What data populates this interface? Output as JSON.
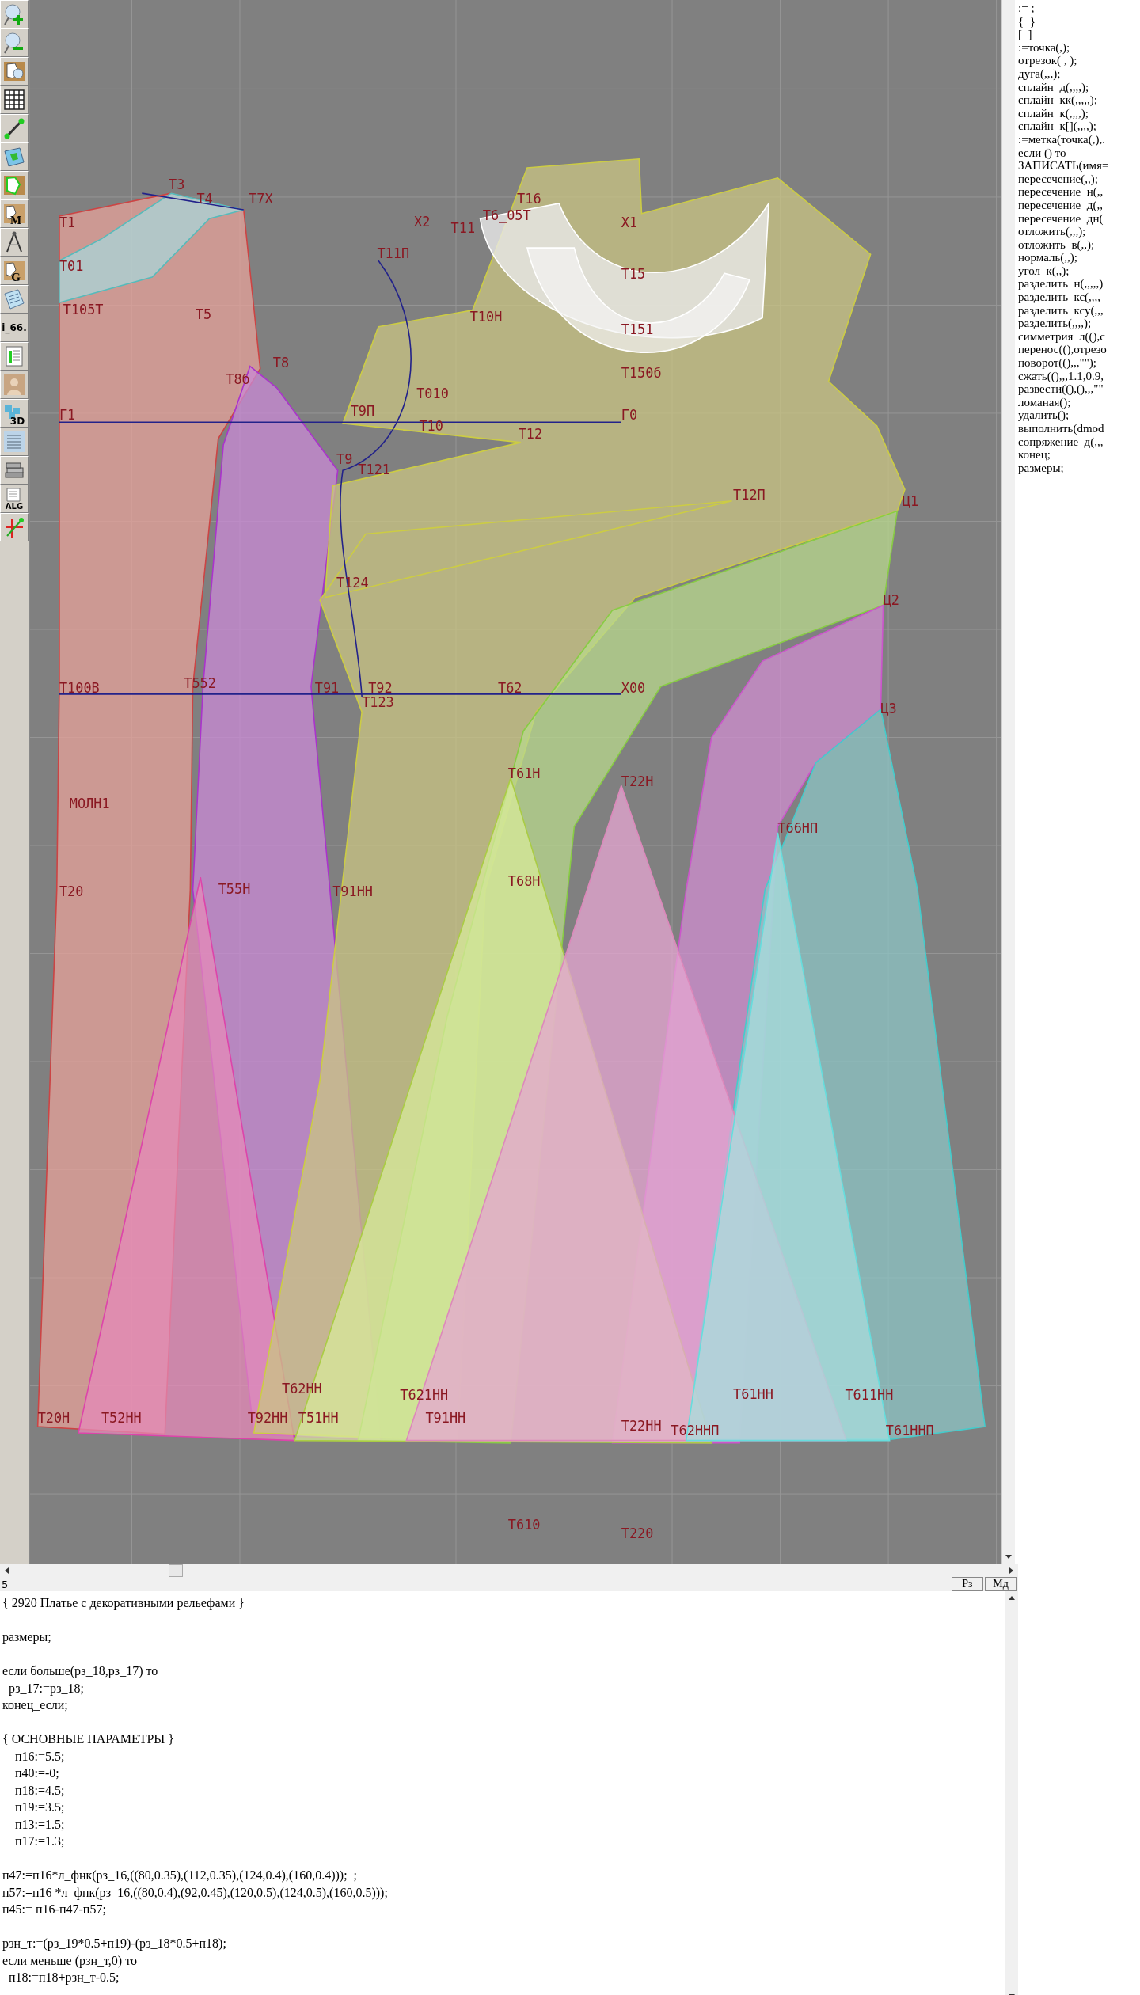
{
  "toolbar": {
    "buttons": [
      {
        "kind": "zoom-in"
      },
      {
        "kind": "zoom-out"
      },
      {
        "kind": "pattern-zoom"
      },
      {
        "kind": "grid"
      },
      {
        "kind": "segment"
      },
      {
        "kind": "map"
      },
      {
        "kind": "pattern-outline"
      },
      {
        "kind": "pattern-letter",
        "text": "M"
      },
      {
        "kind": "compass"
      },
      {
        "kind": "pattern-letter",
        "text": "G"
      },
      {
        "kind": "sheet"
      },
      {
        "kind": "label",
        "text": "i_66."
      },
      {
        "kind": "table"
      },
      {
        "kind": "photo"
      },
      {
        "kind": "cubes",
        "text": "3D"
      },
      {
        "kind": "list"
      },
      {
        "kind": "books"
      },
      {
        "kind": "doc-letter",
        "text": "ALG"
      },
      {
        "kind": "axes"
      }
    ]
  },
  "canvas": {
    "labels": [
      "Т1",
      "Т3",
      "Т4",
      "Т01",
      "Т105Т",
      "Т5",
      "Т7Х",
      "Т8",
      "Т8б",
      "Г1",
      "Т010",
      "Т9П",
      "Т10",
      "Т12",
      "Т9",
      "Т121",
      "Т11П",
      "Х2",
      "Т11",
      "Т16",
      "Т6_05Т",
      "Х1",
      "Т15",
      "Т10Н",
      "Т151",
      "Т150б",
      "Г0",
      "Т12П",
      "Ц1",
      "Ц2",
      "Ц3",
      "Т124",
      "Т100В",
      "Т552",
      "Т91",
      "Т92",
      "Т123",
      "Т62",
      "Х00",
      "Т61Н",
      "Т22Н",
      "Т66НП",
      "МОЛН1",
      "Т20",
      "Т55Н",
      "Т91НН",
      "Т68Н",
      "Т62НН",
      "Т621НН",
      "Т61НН",
      "Т611НН",
      "Т20Н",
      "Т52НН",
      "Т92НН",
      "Т51НН",
      "Т91НН",
      "Т22НН",
      "Т62ННП",
      "Т61ННП",
      "Т610",
      "Т220"
    ]
  },
  "status_bar": {
    "value": "5",
    "buttons": [
      "Рз",
      "Мд"
    ]
  },
  "command_list": [
    ":= ;",
    "{  }",
    "[  ]",
    ":=точка(,);",
    "отрезок( , );",
    "дуга(,,,);",
    "сплайн  д(,,,,);",
    "сплайн  кк(,,,,,);",
    "сплайн  к(,,,,);",
    "сплайн  к[](,,,,);",
    ":=метка(точка(,),.",
    "если () то",
    "ЗАПИСАТЬ(имя=",
    "пересечение(,,);",
    "пересечение  н(,,",
    "пересечение  д(,,",
    "пересечение  дн(",
    "отложить(,,,);",
    "отложить  в(,,);",
    "нормаль(,,);",
    "угол  к(,,);",
    "разделить  н(,,,,,)",
    "разделить  кс(,,,,",
    "разделить  ксу(,,,",
    "разделить(,,,,);",
    "симметрия  л((),с",
    "перенос((),отрезо",
    "поворот((),,,\"\");",
    "сжать((),,,1.1,0.9,",
    "развести((),(),,,\"\"",
    "ломаная();",
    "удалить();",
    "выполнить(dmod",
    "сопряжение  д(,,,",
    "конец;",
    "размеры;"
  ],
  "editor": {
    "blocks": [
      [
        "{ 2920 Платье с декоративными рельефами }"
      ],
      [
        "размеры;"
      ],
      [
        "если больше(рз_18,рз_17) то",
        "  рз_17:=рз_18;",
        "конец_если;"
      ],
      [
        "{ ОСНОВНЫЕ ПАРАМЕТРЫ }",
        "    п16:=5.5;",
        "    п40:=-0;",
        "    п18:=4.5;",
        "    п19:=3.5;",
        "    п13:=1.5;",
        "    п17:=1.3;"
      ],
      [
        "п47:=п16*л_фнк(рз_16,((80,0.35),(112,0.35),(124,0.4),(160,0.4)));  ;",
        "п57:=п16 *л_фнк(рз_16,((80,0.4),(92,0.45),(120,0.5),(124,0.5),(160,0.5)));",
        "п45:= п16-п47-п57;"
      ],
      [
        "рзн_т:=(рз_19*0.5+п19)-(рз_18*0.5+п18);",
        "если меньше (рзн_т,0) то",
        "  п18:=п18+рзн_т-0.5;"
      ]
    ]
  }
}
